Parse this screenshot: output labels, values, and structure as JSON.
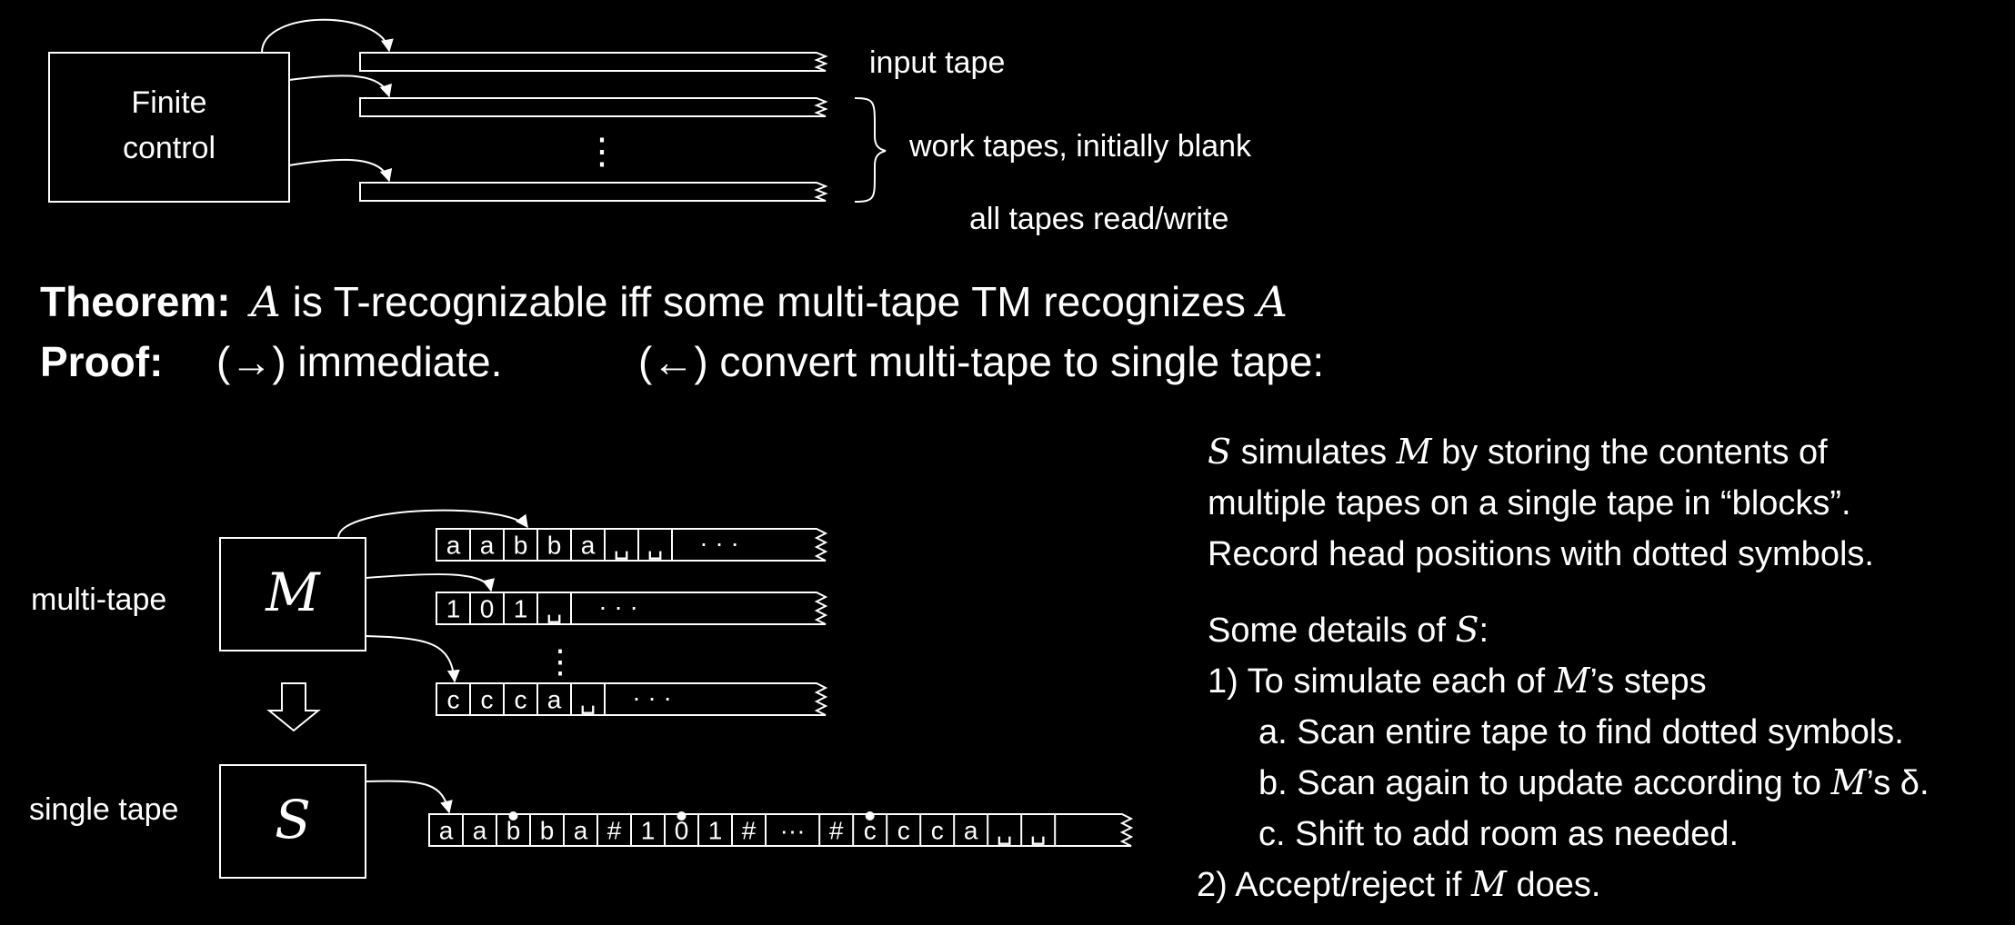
{
  "top": {
    "finite_control": [
      "Finite",
      "control"
    ],
    "input_tape_label": "input tape",
    "work_tapes_label": "work tapes, initially blank",
    "all_tapes_label": "all tapes read/write",
    "vdots": "⋮"
  },
  "theorem": {
    "label": "Theorem:",
    "var": "A",
    "text": " is T-recognizable iff some multi-tape TM recognizes "
  },
  "proof": {
    "label": "Proof:",
    "forward": "(→)  immediate.",
    "backward": "(←)  convert multi-tape to single tape:"
  },
  "bottom": {
    "multi_tape_label": "multi-tape",
    "single_tape_label": "single tape",
    "machine_m": "M",
    "machine_s": "S",
    "tape1": [
      "a",
      "a",
      "b",
      "b",
      "a",
      "␣",
      "␣"
    ],
    "tape2": [
      "1",
      "0",
      "1",
      "␣"
    ],
    "tape3": [
      "c",
      "c",
      "c",
      "a",
      "␣"
    ],
    "ellipsis": "· · ·",
    "single": [
      "a",
      "a",
      "b",
      "b",
      "a",
      "#",
      "1",
      "0",
      "1",
      "#",
      "···",
      "#",
      "c",
      "c",
      "c",
      "a",
      "␣",
      "␣"
    ],
    "vdots": "⋮"
  },
  "explain": {
    "p1": [
      {
        "v": "S"
      },
      {
        "t": " simulates "
      },
      {
        "v": "M"
      },
      {
        "t": " by storing the contents of"
      }
    ],
    "p1_line2": "multiple tapes on a single tape in “blocks”.",
    "p1_line3": "Record head positions with dotted symbols.",
    "details_prefix": "Some details of ",
    "details_var": "S",
    "details_suffix": ":",
    "step1_prefix": "1)  To simulate each of ",
    "step1_var": "M",
    "step1_suffix": "’s steps",
    "step_a": "a.  Scan entire tape to find dotted symbols.",
    "step_b_prefix": "b.  Scan again to update according to ",
    "step_b_var": "M",
    "step_b_suffix": "’s  δ.",
    "step_c": "c.  Shift to add room as needed.",
    "step2_prefix": "2)  Accept/reject if ",
    "step2_var": "M",
    "step2_suffix": " does."
  }
}
